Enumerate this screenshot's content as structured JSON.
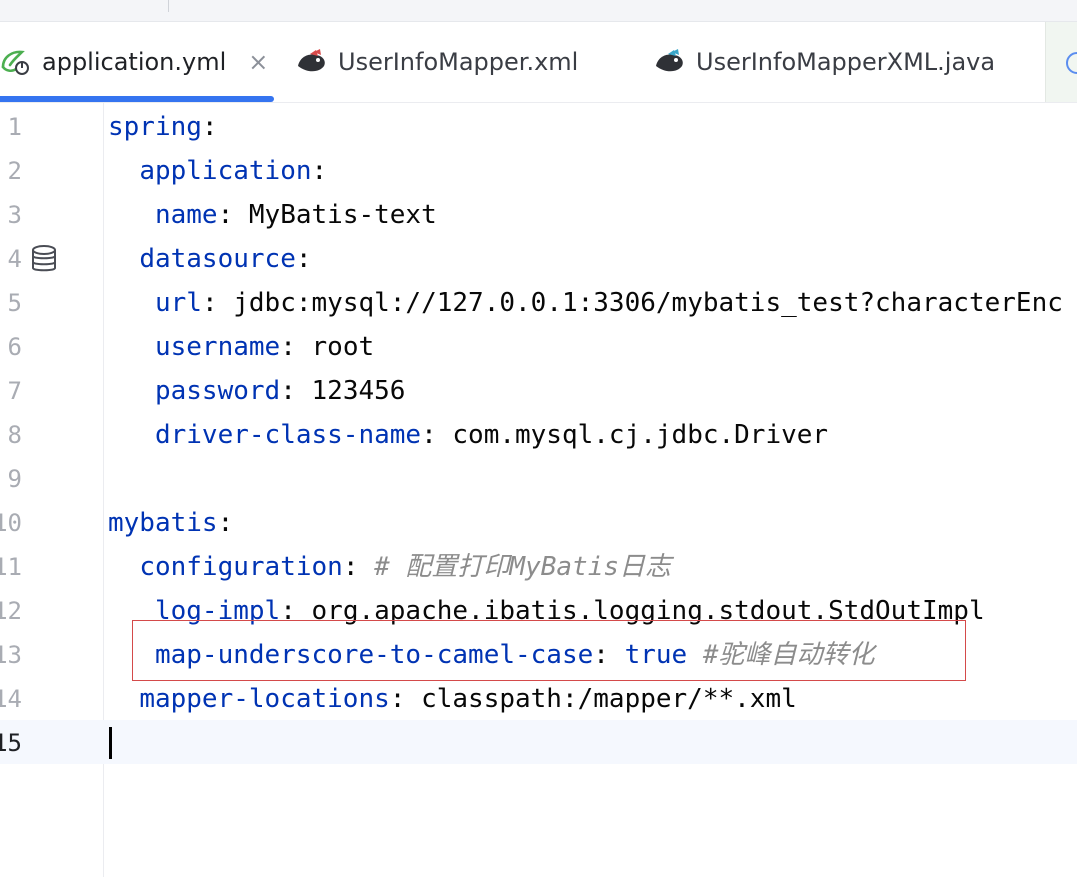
{
  "tabs": [
    {
      "label": "application.yml",
      "icon": "spring-yaml-icon",
      "active": true,
      "close": "×"
    },
    {
      "label": "UserInfoMapper.xml",
      "icon": "mybatis-bird-icon",
      "active": false
    },
    {
      "label": "UserInfoMapperXML.java",
      "icon": "mybatis-bird-icon",
      "active": false
    }
  ],
  "colors": {
    "accent": "#3574f0",
    "key": "#0033b3",
    "comment": "#8c8c8c",
    "highlight_box": "#d44a4a"
  },
  "editor": {
    "lines": [
      {
        "num": "1",
        "indent": "",
        "key": "spring",
        "colon": ":",
        "value": "",
        "comment": ""
      },
      {
        "num": "2",
        "indent": "  ",
        "key": "application",
        "colon": ":",
        "value": "",
        "comment": ""
      },
      {
        "num": "3",
        "indent": "   ",
        "key": "name",
        "colon": ":",
        "value": " MyBatis-text",
        "comment": ""
      },
      {
        "num": "4",
        "indent": "  ",
        "key": "datasource",
        "colon": ":",
        "value": "",
        "comment": ""
      },
      {
        "num": "5",
        "indent": "   ",
        "key": "url",
        "colon": ":",
        "value": " jdbc:mysql://127.0.0.1:3306/mybatis_test?characterEnc",
        "comment": ""
      },
      {
        "num": "6",
        "indent": "   ",
        "key": "username",
        "colon": ":",
        "value": " root",
        "comment": ""
      },
      {
        "num": "7",
        "indent": "   ",
        "key": "password",
        "colon": ":",
        "value": " 123456",
        "comment": ""
      },
      {
        "num": "8",
        "indent": "   ",
        "key": "driver-class-name",
        "colon": ":",
        "value": " com.mysql.cj.jdbc.Driver",
        "comment": ""
      },
      {
        "num": "9",
        "indent": "",
        "key": "",
        "colon": "",
        "value": "",
        "comment": ""
      },
      {
        "num": "10",
        "indent": "",
        "key": "mybatis",
        "colon": ":",
        "value": "",
        "comment": ""
      },
      {
        "num": "11",
        "indent": "  ",
        "key": "configuration",
        "colon": ":",
        "value": " ",
        "comment": "# 配置打印MyBatis日志"
      },
      {
        "num": "12",
        "indent": "   ",
        "key": "log-impl",
        "colon": ":",
        "value": " org.apache.ibatis.logging.stdout.StdOutImpl",
        "comment": ""
      },
      {
        "num": "13",
        "indent": "   ",
        "key": "map-underscore-to-camel-case",
        "colon": ":",
        "value": " ",
        "bool": "true",
        "comment": " #驼峰自动转化"
      },
      {
        "num": "14",
        "indent": "  ",
        "key": "mapper-locations",
        "colon": ":",
        "value": " classpath:/mapper/**.xml",
        "comment": ""
      },
      {
        "num": "15",
        "indent": "",
        "key": "",
        "colon": "",
        "value": "",
        "comment": "",
        "current": true
      }
    ]
  },
  "gutter_icons": {
    "line4": "database-icon"
  }
}
